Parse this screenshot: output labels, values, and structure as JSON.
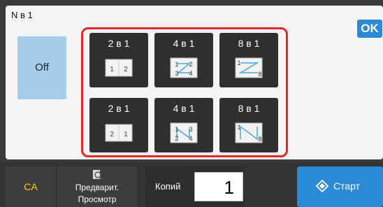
{
  "header": {
    "title": "N в 1",
    "ok_label": "OK"
  },
  "options": {
    "off_label": "Off",
    "tiles": [
      {
        "label": "2 в 1",
        "icon": "layout-2in1-ltr-icon",
        "nums": [
          "1",
          "2"
        ]
      },
      {
        "label": "4 в 1",
        "icon": "layout-4in1-z-icon",
        "nums": [
          "1",
          "2",
          "3",
          "4"
        ]
      },
      {
        "label": "8 в 1",
        "icon": "layout-8in1-z-icon",
        "nums": [
          "1",
          "8"
        ]
      },
      {
        "label": "2 в 1",
        "icon": "layout-2in1-rtl-icon",
        "nums": [
          "2",
          "1"
        ]
      },
      {
        "label": "4 в 1",
        "icon": "layout-4in1-n-icon",
        "nums": [
          "1",
          "3",
          "2",
          "4"
        ]
      },
      {
        "label": "8 в 1",
        "icon": "layout-8in1-n-icon",
        "nums": [
          "1",
          "8"
        ]
      }
    ]
  },
  "footer": {
    "ca_label": "CA",
    "preview_line1": "Предварит.",
    "preview_line2": "Просмотр",
    "copies_label": "Копий",
    "copies_value": "1",
    "start_label": "Старт"
  }
}
